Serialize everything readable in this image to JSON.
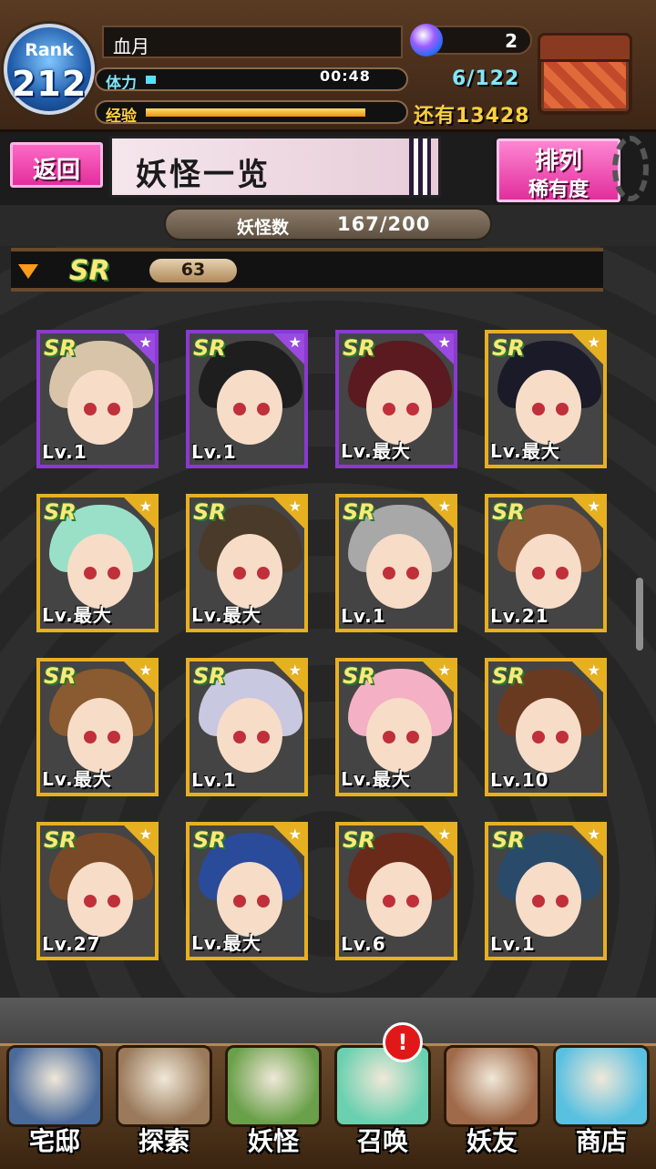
{
  "player": {
    "rank_label": "Rank",
    "rank": "212",
    "name": "血月",
    "stamina_label": "体力",
    "stamina_timer": "00:48",
    "stamina_fraction": 0.04,
    "exp_label": "经验",
    "exp_fraction": 0.86,
    "orbs": "2",
    "box_count": "6/122",
    "exp_remaining": "还有13428"
  },
  "header": {
    "back_label": "返回",
    "title": "妖怪一览",
    "sort_title": "排列",
    "sort_value": "稀有度"
  },
  "collection": {
    "count_label": "妖怪数",
    "count_value": "167/200"
  },
  "section": {
    "rarity": "SR",
    "count": "63"
  },
  "cards": [
    {
      "rarity": "SR",
      "level": "Lv.1",
      "frame": "purple",
      "hair": "#d8c4a8"
    },
    {
      "rarity": "SR",
      "level": "Lv.1",
      "frame": "purple",
      "hair": "#1e1e1e"
    },
    {
      "rarity": "SR",
      "level": "Lv.最大",
      "frame": "purple",
      "hair": "#5a1a20"
    },
    {
      "rarity": "SR",
      "level": "Lv.最大",
      "frame": "gold",
      "hair": "#1a1a28"
    },
    {
      "rarity": "SR",
      "level": "Lv.最大",
      "frame": "gold",
      "hair": "#9ae0c8"
    },
    {
      "rarity": "SR",
      "level": "Lv.最大",
      "frame": "gold",
      "hair": "#4a3a2a"
    },
    {
      "rarity": "SR",
      "level": "Lv.1",
      "frame": "gold",
      "hair": "#a8a8a8"
    },
    {
      "rarity": "SR",
      "level": "Lv.21",
      "frame": "gold",
      "hair": "#8a5a38"
    },
    {
      "rarity": "SR",
      "level": "Lv.最大",
      "frame": "gold",
      "hair": "#8a5a30"
    },
    {
      "rarity": "SR",
      "level": "Lv.1",
      "frame": "gold",
      "hair": "#c8c8e0"
    },
    {
      "rarity": "SR",
      "level": "Lv.最大",
      "frame": "gold",
      "hair": "#f4b0c4"
    },
    {
      "rarity": "SR",
      "level": "Lv.10",
      "frame": "gold",
      "hair": "#6a3a20"
    },
    {
      "rarity": "SR",
      "level": "Lv.27",
      "frame": "gold",
      "hair": "#7a4a28"
    },
    {
      "rarity": "SR",
      "level": "Lv.最大",
      "frame": "gold",
      "hair": "#2a4a9a"
    },
    {
      "rarity": "SR",
      "level": "Lv.6",
      "frame": "gold",
      "hair": "#6a2a1a"
    },
    {
      "rarity": "SR",
      "level": "Lv.1",
      "frame": "gold",
      "hair": "#2a4a6a"
    }
  ],
  "nav": [
    {
      "label": "宅邸",
      "icon": "mansion-icon",
      "color": "#4a6a9a"
    },
    {
      "label": "探索",
      "icon": "magnifier-icon",
      "color": "#9a7a5a"
    },
    {
      "label": "妖怪",
      "icon": "scroll-icon",
      "color": "#6aa04a"
    },
    {
      "label": "召唤",
      "icon": "star-summon-icon",
      "color": "#6ad0b0"
    },
    {
      "label": "妖友",
      "icon": "friend-icon",
      "color": "#a06a4a"
    },
    {
      "label": "商店",
      "icon": "orb-shop-icon",
      "color": "#5ac0e0"
    }
  ],
  "alert": "!",
  "colors": {
    "accent_pink": "#e02a9a",
    "gold_frame": "#e6b020",
    "purple_frame": "#8a3ad0"
  }
}
